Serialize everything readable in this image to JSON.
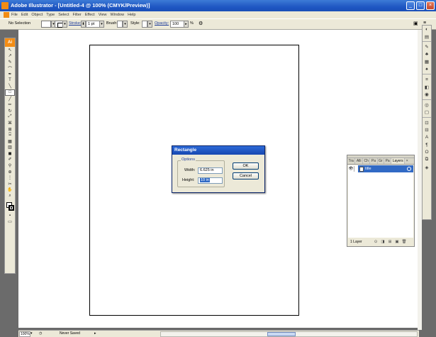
{
  "window": {
    "title": "Adobe Illustrator - [Untitled-4 @ 100% (CMYK/Preview)]",
    "min": "_",
    "max": "□",
    "close": "×"
  },
  "menu": [
    "File",
    "Edit",
    "Object",
    "Type",
    "Select",
    "Filter",
    "Effect",
    "View",
    "Window",
    "Help"
  ],
  "control": {
    "selection": "No Selection",
    "stroke_label": "Stroke:",
    "stroke_value": "1 pt",
    "brush_label": "Brush:",
    "style_label": "Style:",
    "opacity_label": "Opacity:",
    "opacity_value": "100",
    "opacity_unit": "%"
  },
  "toolbox": {
    "logo": "Ai",
    "tools": [
      "↖",
      "↗",
      "✎",
      "⌒",
      "✒",
      "T",
      "╲",
      "□",
      "╱",
      "✏",
      "↻",
      "⤢",
      "⌘",
      "⊞",
      "⌹",
      "▦",
      "▥",
      "◼",
      "✐",
      "⚲",
      "⊕",
      "⋮",
      "✂",
      "✋",
      "⌕"
    ]
  },
  "dialog": {
    "title": "Rectangle",
    "group_label": "Options",
    "width_label": "Width:",
    "width_value": "6.625 in",
    "height_label": "Height:",
    "height_value": "10 in",
    "ok_label": "OK",
    "cancel_label": "Cancel"
  },
  "layers_panel": {
    "tabs": [
      "Tra",
      "Alli",
      "Ch",
      "Pa",
      "Gr",
      "Pa",
      "Layers"
    ],
    "layer_name": "title",
    "footer_count": "1 Layer"
  },
  "status": {
    "zoom": "100%",
    "save_state": "Never Saved"
  }
}
